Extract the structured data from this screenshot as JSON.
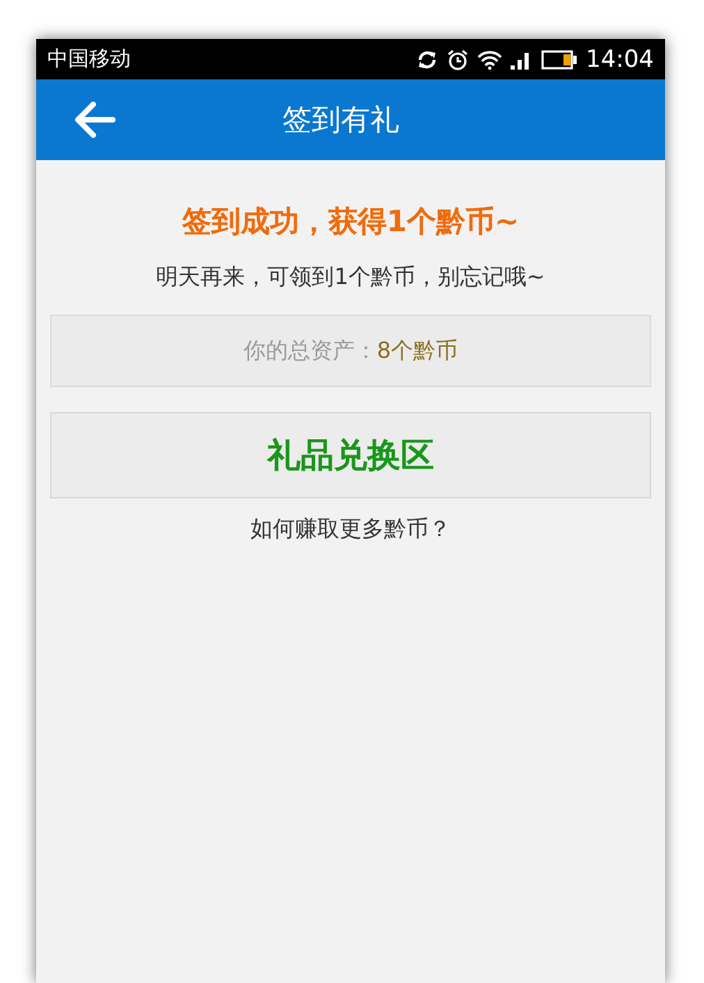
{
  "status_bar": {
    "carrier": "中国移动",
    "time": "14:04"
  },
  "app_bar": {
    "title": "签到有礼"
  },
  "headline": "签到成功，获得1个黔币~",
  "subtitle": "明天再来，可领到1个黔币，别忘记哦~",
  "assets": {
    "label": "你的总资产：",
    "value": "8个黔币"
  },
  "exchange_button": "礼品兑换区",
  "earn_link": "如何赚取更多黔币？"
}
